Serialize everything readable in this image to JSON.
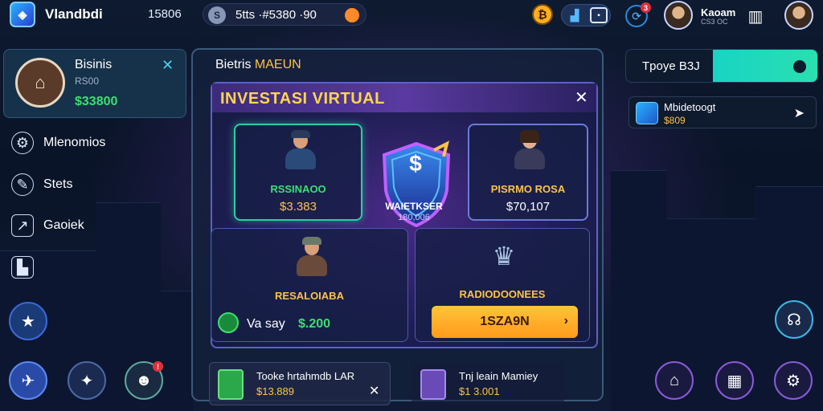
{
  "topbar": {
    "app_title": "Vlandbdi",
    "stat": "15806",
    "pill_text": "5tts ·#5380 ·90",
    "pill_coin": "S",
    "pill_orb": "G",
    "right_notif": "3",
    "user_name": "Kaoam",
    "user_sub": "CS3 OC"
  },
  "profile": {
    "name": "Bisinis",
    "sub": "RS00",
    "balance": "$33800"
  },
  "sidebar": {
    "items": [
      {
        "label": "Mlenomios",
        "icon": "gear-icon"
      },
      {
        "label": "Stets",
        "icon": "pen-icon"
      },
      {
        "label": "Gaoiek",
        "icon": "chart-icon"
      },
      {
        "label": "",
        "icon": "bar-chart-icon"
      }
    ]
  },
  "modal": {
    "outer_title": "Bietris",
    "outer_title_accent": "MAEUN",
    "title": "INVESTASI VIRTUAL",
    "cards": [
      {
        "name": "RSSINAOO",
        "amount": "$3.383",
        "name_color": "#3ae070"
      },
      {
        "name": "PISRMO ROSA",
        "amount": "$70,107",
        "name_color": "#ffc24a"
      },
      {
        "name": "RESALOIABA",
        "amount": "",
        "name_color": "#ffc24a"
      },
      {
        "name": "RADIODOONEES",
        "amount": "",
        "name_color": "#ffc24a"
      }
    ],
    "shield_label": "WAIETKSER",
    "shield_value": "180,006",
    "shield_symbol": "$",
    "daily_label": "Va say",
    "daily_value": "$.200",
    "invest_button": "1SZA9N"
  },
  "right_panel": {
    "search_label": "Tpoye B3J",
    "card_title": "Mbidetoogt",
    "card_value": "$809"
  },
  "bottom": {
    "card1_title": "Tooke hrtahmdb LAR",
    "card1_value": "$13.889",
    "card2_title": "Tnj leain Mamiey",
    "card2_value": "$1 3.001",
    "notif_badge": "!"
  },
  "colors": {
    "accent_gold": "#ffc24a",
    "accent_green": "#3ae070",
    "accent_cyan": "#18d4c4",
    "panel_bg": "#16324a"
  }
}
